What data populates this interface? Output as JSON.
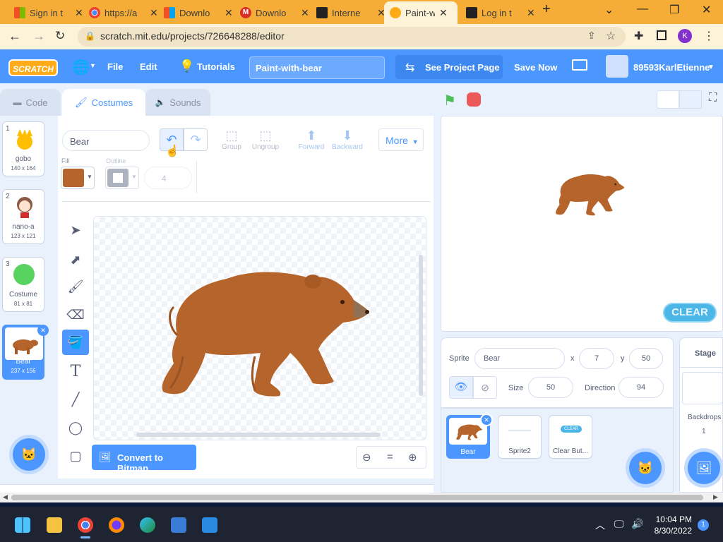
{
  "browser": {
    "tabs": [
      {
        "title": "Sign in t",
        "icon": "microsoft-icon"
      },
      {
        "title": "https://a",
        "icon": "chrome-icon"
      },
      {
        "title": "Downlo",
        "icon": "microsoft-icon"
      },
      {
        "title": "Downlo",
        "icon": "gmail-icon"
      },
      {
        "title": "Interne",
        "icon": "archive-icon"
      },
      {
        "title": "Paint-w",
        "icon": "scratch-icon"
      },
      {
        "title": "Log in t",
        "icon": "archive-icon"
      }
    ],
    "url": "scratch.mit.edu/projects/726648288/editor",
    "profile_initial": "K"
  },
  "menubar": {
    "logo": "SCRATCH",
    "file": "File",
    "edit": "Edit",
    "tutorials": "Tutorials",
    "project_title": "Paint-with-bear",
    "see_project": "See Project Page",
    "save_now": "Save Now",
    "username": "89593KarlEtienne"
  },
  "editor_tabs": {
    "code": "Code",
    "costumes": "Costumes",
    "sounds": "Sounds"
  },
  "costumes": [
    {
      "num": "1",
      "name": "gobo",
      "size": "140 x 164"
    },
    {
      "num": "2",
      "name": "nano-a",
      "size": "123 x 121"
    },
    {
      "num": "3",
      "name": "Costume",
      "size": "81 x 81"
    },
    {
      "num": "4",
      "name": "Bear",
      "size": "237 x 156"
    }
  ],
  "paint": {
    "costume_name": "Bear",
    "group": "Group",
    "ungroup": "Ungroup",
    "forward": "Forward",
    "backward": "Backward",
    "more": "More",
    "fill_label": "Fill",
    "outline_label": "Outline",
    "outline_width": "4",
    "convert": "Convert to Bitmap",
    "zoom_reset": "=",
    "fill_color": "#b5652b"
  },
  "stage": {
    "clear_button": "CLEAR"
  },
  "sprite_info": {
    "sprite_label": "Sprite",
    "sprite_name": "Bear",
    "x_label": "x",
    "x": "7",
    "y_label": "y",
    "y": "50",
    "size_label": "Size",
    "size": "50",
    "direction_label": "Direction",
    "direction": "94"
  },
  "sprites": [
    {
      "name": "Bear"
    },
    {
      "name": "Sprite2"
    },
    {
      "name": "Clear But..."
    }
  ],
  "clear_thumb": "CLEAR",
  "stage_panel": {
    "title": "Stage",
    "backdrops_label": "Backdrops",
    "backdrops_count": "1"
  },
  "taskbar": {
    "time": "10:04 PM",
    "date": "8/30/2022",
    "notifications": "1"
  }
}
